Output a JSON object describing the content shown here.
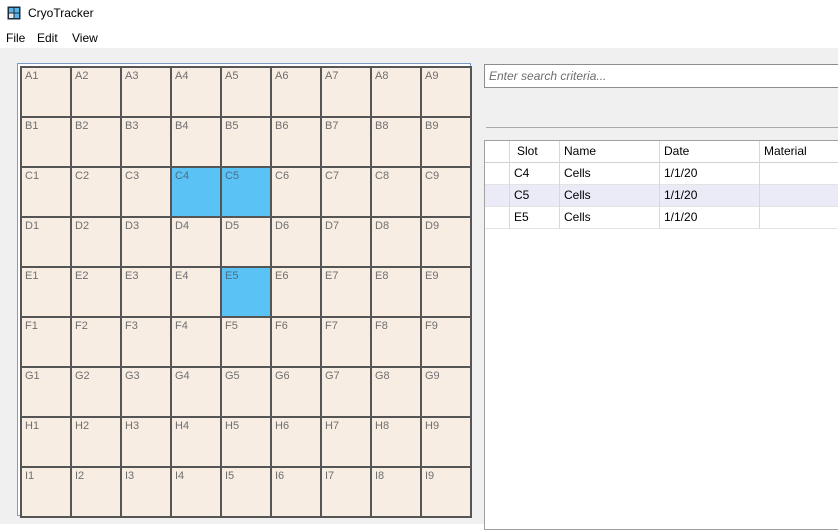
{
  "window": {
    "title": "CryoTracker",
    "icon": "grid-app-icon"
  },
  "menu": {
    "file": "File",
    "edit": "Edit",
    "view": "View"
  },
  "grid": {
    "rows": [
      [
        "A1",
        "A2",
        "A3",
        "A4",
        "A5",
        "A6",
        "A7",
        "A8",
        "A9"
      ],
      [
        "B1",
        "B2",
        "B3",
        "B4",
        "B5",
        "B6",
        "B7",
        "B8",
        "B9"
      ],
      [
        "C1",
        "C2",
        "C3",
        "C4",
        "C5",
        "C6",
        "C7",
        "C8",
        "C9"
      ],
      [
        "D1",
        "D2",
        "D3",
        "D4",
        "D5",
        "D6",
        "D7",
        "D8",
        "D9"
      ],
      [
        "E1",
        "E2",
        "E3",
        "E4",
        "E5",
        "E6",
        "E7",
        "E8",
        "E9"
      ],
      [
        "F1",
        "F2",
        "F3",
        "F4",
        "F5",
        "F6",
        "F7",
        "F8",
        "F9"
      ],
      [
        "G1",
        "G2",
        "G3",
        "G4",
        "G5",
        "G6",
        "G7",
        "G8",
        "G9"
      ],
      [
        "H1",
        "H2",
        "H3",
        "H4",
        "H5",
        "H6",
        "H7",
        "H8",
        "H9"
      ],
      [
        "I1",
        "I2",
        "I3",
        "I4",
        "I5",
        "I6",
        "I7",
        "I8",
        "I9"
      ]
    ],
    "selected": [
      "C4",
      "C5",
      "E5"
    ],
    "colors": {
      "cell": "#f8ede3",
      "selected": "#5bc2f5",
      "border": "#555555"
    }
  },
  "search": {
    "placeholder": "Enter search criteria..."
  },
  "table": {
    "headers": [
      "Slot",
      "Name",
      "Date",
      "Material"
    ],
    "rows": [
      [
        "C4",
        "Cells",
        "1/1/20",
        ""
      ],
      [
        "C5",
        "Cells",
        "1/1/20",
        ""
      ],
      [
        "E5",
        "Cells",
        "1/1/20",
        ""
      ]
    ],
    "colors": {
      "alt_row": "#ebebf7"
    }
  }
}
